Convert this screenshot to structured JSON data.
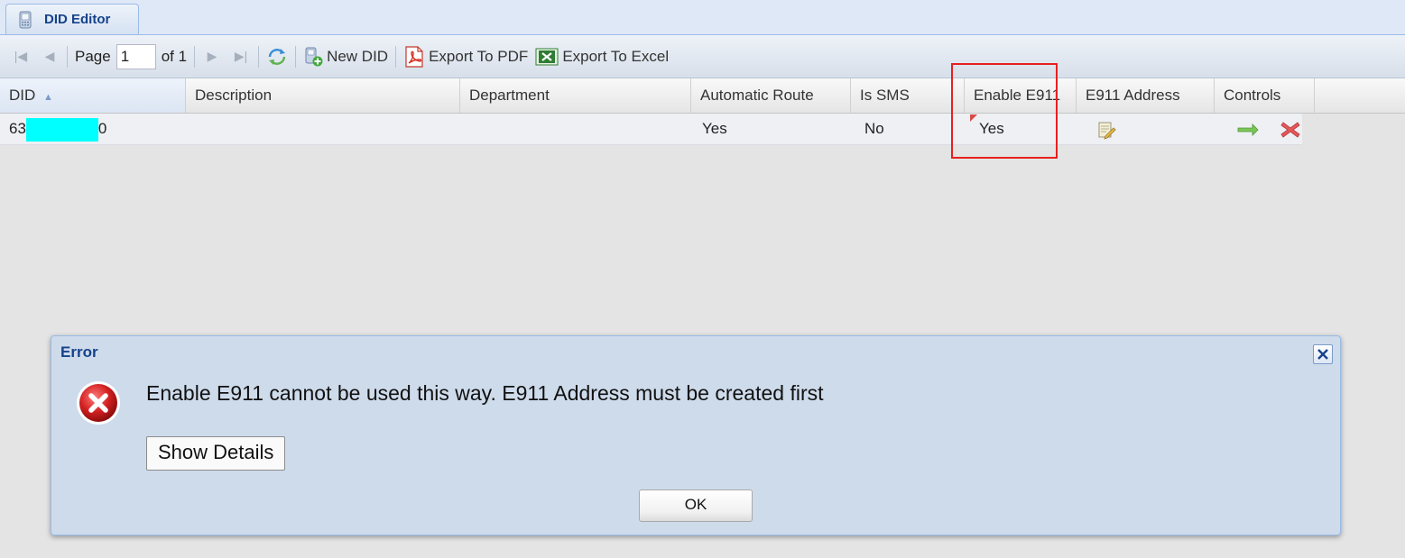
{
  "tab": {
    "label": "DID Editor"
  },
  "toolbar": {
    "page_label": "Page",
    "page_value": "1",
    "of_label": "of 1",
    "new_did": "New DID",
    "export_pdf": "Export To PDF",
    "export_excel": "Export To Excel"
  },
  "grid": {
    "columns": [
      "DID",
      "Description",
      "Department",
      "Automatic Route",
      "Is SMS",
      "Enable E911",
      "E911 Address",
      "Controls"
    ],
    "sort_indicator": "▲",
    "rows": [
      {
        "did_prefix": "63",
        "did_suffix": "0",
        "description": "",
        "department": "",
        "automatic_route": "Yes",
        "is_sms": "No",
        "enable_e911": "Yes"
      }
    ]
  },
  "dialog": {
    "title": "Error",
    "message": "Enable E911 cannot be used this way.  E911 Address must be created first",
    "details_button": "Show Details",
    "ok_button": "OK"
  },
  "colors": {
    "accent": "#15428b",
    "highlight": "#e8201e",
    "redaction": "#00ffff"
  }
}
